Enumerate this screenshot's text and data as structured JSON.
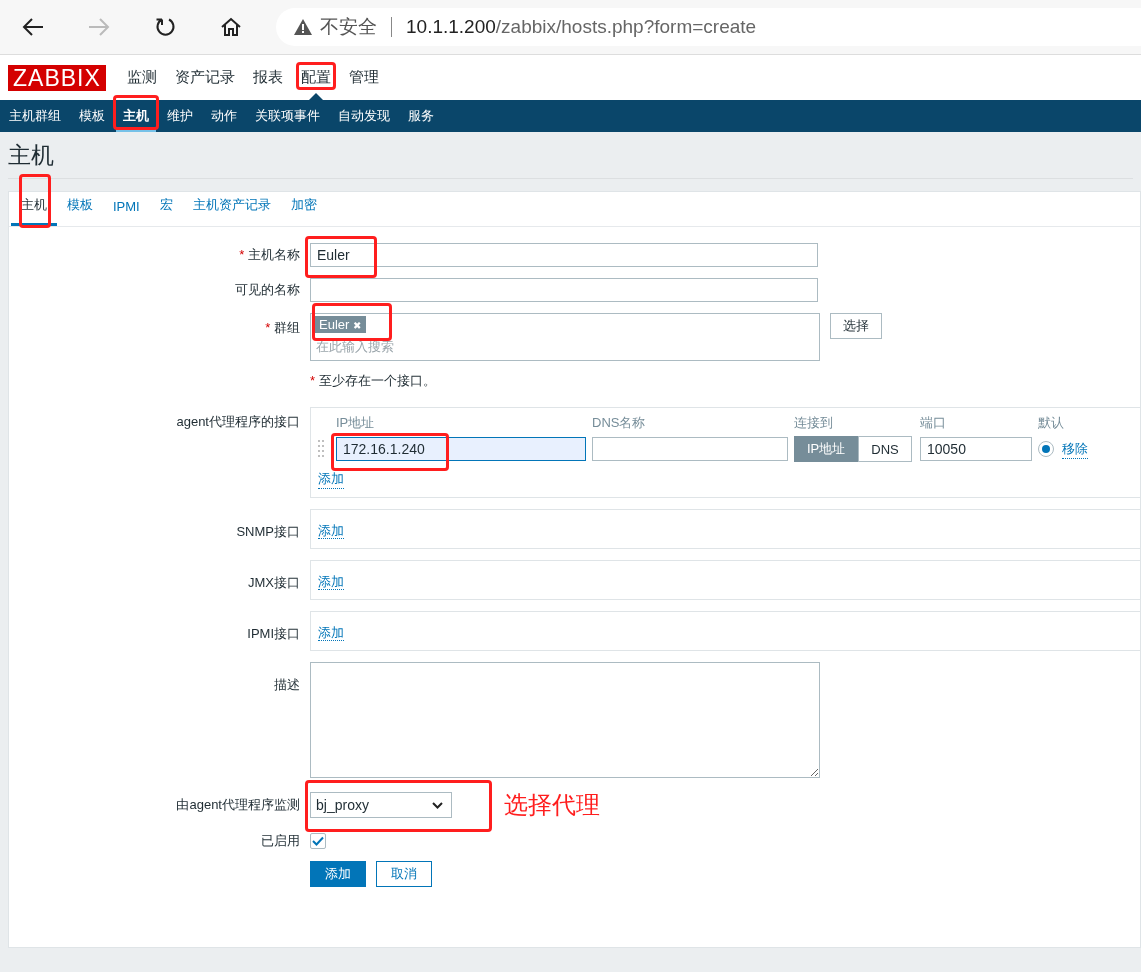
{
  "browser": {
    "security": "不安全",
    "url_host": "10.1.1.200",
    "url_path": "/zabbix/hosts.php?form=create"
  },
  "logo": "ZABBIX",
  "main_menu": [
    {
      "label": "监测",
      "selected": false,
      "annotated": false
    },
    {
      "label": "资产记录",
      "selected": false,
      "annotated": false
    },
    {
      "label": "报表",
      "selected": false,
      "annotated": false
    },
    {
      "label": "配置",
      "selected": true,
      "annotated": true
    },
    {
      "label": "管理",
      "selected": false,
      "annotated": false
    }
  ],
  "sub_menu": [
    {
      "label": "主机群组",
      "selected": false,
      "annotated": false
    },
    {
      "label": "模板",
      "selected": false,
      "annotated": false
    },
    {
      "label": "主机",
      "selected": true,
      "annotated": true
    },
    {
      "label": "维护",
      "selected": false,
      "annotated": false
    },
    {
      "label": "动作",
      "selected": false,
      "annotated": false
    },
    {
      "label": "关联项事件",
      "selected": false,
      "annotated": false
    },
    {
      "label": "自动发现",
      "selected": false,
      "annotated": false
    },
    {
      "label": "服务",
      "selected": false,
      "annotated": false
    }
  ],
  "page_title": "主机",
  "tabs": [
    {
      "label": "主机",
      "selected": true,
      "annotated": true
    },
    {
      "label": "模板",
      "selected": false,
      "annotated": false
    },
    {
      "label": "IPMI",
      "selected": false,
      "annotated": false
    },
    {
      "label": "宏",
      "selected": false,
      "annotated": false
    },
    {
      "label": "主机资产记录",
      "selected": false,
      "annotated": false
    },
    {
      "label": "加密",
      "selected": false,
      "annotated": false
    }
  ],
  "host_name": {
    "required_mark": "*",
    "label": "主机名称",
    "value": "Euler",
    "annotated": true
  },
  "visible_name": {
    "label": "可见的名称"
  },
  "groups": {
    "required_mark": "*",
    "label": "群组",
    "tags": [
      {
        "label": "Euler",
        "remove": "✖",
        "annotated": true
      }
    ],
    "placeholder": "在此输入搜索",
    "select_button": "选择"
  },
  "interface_note": {
    "mark": "*",
    "text": "至少存在一个接口。"
  },
  "agent_interfaces": {
    "label": "agent代理程序的接口",
    "columns": [
      "IP地址",
      "DNS名称",
      "连接到",
      "端口",
      "默认"
    ],
    "rows": [
      {
        "ip": "172.16.1.240",
        "ip_annotated": true,
        "connect_to": [
          {
            "label": "IP地址",
            "selected": true
          },
          {
            "label": "DNS",
            "selected": false
          }
        ],
        "port": "10050",
        "default": true,
        "remove": "移除"
      }
    ],
    "add": "添加"
  },
  "other_interfaces": [
    {
      "label": "SNMP接口",
      "add": "添加"
    },
    {
      "label": "JMX接口",
      "add": "添加"
    },
    {
      "label": "IPMI接口",
      "add": "添加"
    }
  ],
  "description": {
    "label": "描述"
  },
  "proxy": {
    "label": "由agent代理程序监测",
    "value": "bj_proxy",
    "annotated": true,
    "note": "选择代理"
  },
  "enabled": {
    "label": "已启用",
    "checked": true
  },
  "buttons": [
    {
      "label": "添加",
      "kind": "primary"
    },
    {
      "label": "取消",
      "kind": "secondary"
    }
  ]
}
